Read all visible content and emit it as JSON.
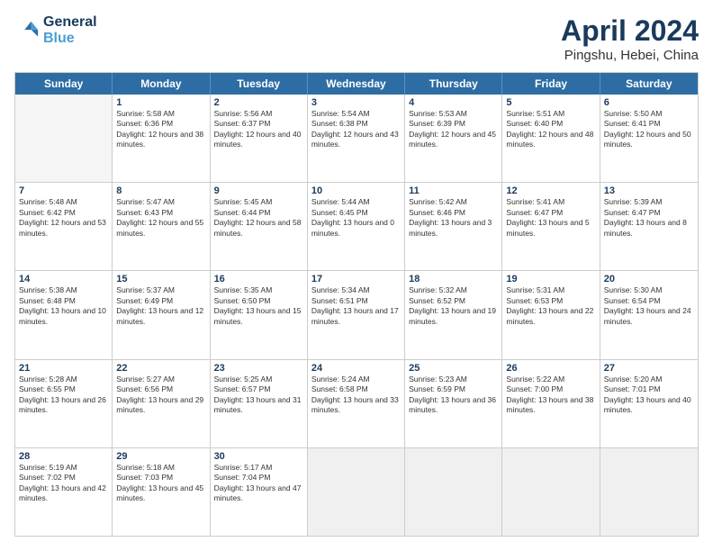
{
  "header": {
    "logo_line1": "General",
    "logo_line2": "Blue",
    "month": "April 2024",
    "location": "Pingshu, Hebei, China"
  },
  "days_of_week": [
    "Sunday",
    "Monday",
    "Tuesday",
    "Wednesday",
    "Thursday",
    "Friday",
    "Saturday"
  ],
  "weeks": [
    [
      {
        "day": "",
        "rise": "",
        "set": "",
        "daylight": "",
        "empty": true
      },
      {
        "day": "1",
        "rise": "Sunrise: 5:58 AM",
        "set": "Sunset: 6:36 PM",
        "daylight": "Daylight: 12 hours and 38 minutes."
      },
      {
        "day": "2",
        "rise": "Sunrise: 5:56 AM",
        "set": "Sunset: 6:37 PM",
        "daylight": "Daylight: 12 hours and 40 minutes."
      },
      {
        "day": "3",
        "rise": "Sunrise: 5:54 AM",
        "set": "Sunset: 6:38 PM",
        "daylight": "Daylight: 12 hours and 43 minutes."
      },
      {
        "day": "4",
        "rise": "Sunrise: 5:53 AM",
        "set": "Sunset: 6:39 PM",
        "daylight": "Daylight: 12 hours and 45 minutes."
      },
      {
        "day": "5",
        "rise": "Sunrise: 5:51 AM",
        "set": "Sunset: 6:40 PM",
        "daylight": "Daylight: 12 hours and 48 minutes."
      },
      {
        "day": "6",
        "rise": "Sunrise: 5:50 AM",
        "set": "Sunset: 6:41 PM",
        "daylight": "Daylight: 12 hours and 50 minutes."
      }
    ],
    [
      {
        "day": "7",
        "rise": "Sunrise: 5:48 AM",
        "set": "Sunset: 6:42 PM",
        "daylight": "Daylight: 12 hours and 53 minutes."
      },
      {
        "day": "8",
        "rise": "Sunrise: 5:47 AM",
        "set": "Sunset: 6:43 PM",
        "daylight": "Daylight: 12 hours and 55 minutes."
      },
      {
        "day": "9",
        "rise": "Sunrise: 5:45 AM",
        "set": "Sunset: 6:44 PM",
        "daylight": "Daylight: 12 hours and 58 minutes."
      },
      {
        "day": "10",
        "rise": "Sunrise: 5:44 AM",
        "set": "Sunset: 6:45 PM",
        "daylight": "Daylight: 13 hours and 0 minutes."
      },
      {
        "day": "11",
        "rise": "Sunrise: 5:42 AM",
        "set": "Sunset: 6:46 PM",
        "daylight": "Daylight: 13 hours and 3 minutes."
      },
      {
        "day": "12",
        "rise": "Sunrise: 5:41 AM",
        "set": "Sunset: 6:47 PM",
        "daylight": "Daylight: 13 hours and 5 minutes."
      },
      {
        "day": "13",
        "rise": "Sunrise: 5:39 AM",
        "set": "Sunset: 6:47 PM",
        "daylight": "Daylight: 13 hours and 8 minutes."
      }
    ],
    [
      {
        "day": "14",
        "rise": "Sunrise: 5:38 AM",
        "set": "Sunset: 6:48 PM",
        "daylight": "Daylight: 13 hours and 10 minutes."
      },
      {
        "day": "15",
        "rise": "Sunrise: 5:37 AM",
        "set": "Sunset: 6:49 PM",
        "daylight": "Daylight: 13 hours and 12 minutes."
      },
      {
        "day": "16",
        "rise": "Sunrise: 5:35 AM",
        "set": "Sunset: 6:50 PM",
        "daylight": "Daylight: 13 hours and 15 minutes."
      },
      {
        "day": "17",
        "rise": "Sunrise: 5:34 AM",
        "set": "Sunset: 6:51 PM",
        "daylight": "Daylight: 13 hours and 17 minutes."
      },
      {
        "day": "18",
        "rise": "Sunrise: 5:32 AM",
        "set": "Sunset: 6:52 PM",
        "daylight": "Daylight: 13 hours and 19 minutes."
      },
      {
        "day": "19",
        "rise": "Sunrise: 5:31 AM",
        "set": "Sunset: 6:53 PM",
        "daylight": "Daylight: 13 hours and 22 minutes."
      },
      {
        "day": "20",
        "rise": "Sunrise: 5:30 AM",
        "set": "Sunset: 6:54 PM",
        "daylight": "Daylight: 13 hours and 24 minutes."
      }
    ],
    [
      {
        "day": "21",
        "rise": "Sunrise: 5:28 AM",
        "set": "Sunset: 6:55 PM",
        "daylight": "Daylight: 13 hours and 26 minutes."
      },
      {
        "day": "22",
        "rise": "Sunrise: 5:27 AM",
        "set": "Sunset: 6:56 PM",
        "daylight": "Daylight: 13 hours and 29 minutes."
      },
      {
        "day": "23",
        "rise": "Sunrise: 5:25 AM",
        "set": "Sunset: 6:57 PM",
        "daylight": "Daylight: 13 hours and 31 minutes."
      },
      {
        "day": "24",
        "rise": "Sunrise: 5:24 AM",
        "set": "Sunset: 6:58 PM",
        "daylight": "Daylight: 13 hours and 33 minutes."
      },
      {
        "day": "25",
        "rise": "Sunrise: 5:23 AM",
        "set": "Sunset: 6:59 PM",
        "daylight": "Daylight: 13 hours and 36 minutes."
      },
      {
        "day": "26",
        "rise": "Sunrise: 5:22 AM",
        "set": "Sunset: 7:00 PM",
        "daylight": "Daylight: 13 hours and 38 minutes."
      },
      {
        "day": "27",
        "rise": "Sunrise: 5:20 AM",
        "set": "Sunset: 7:01 PM",
        "daylight": "Daylight: 13 hours and 40 minutes."
      }
    ],
    [
      {
        "day": "28",
        "rise": "Sunrise: 5:19 AM",
        "set": "Sunset: 7:02 PM",
        "daylight": "Daylight: 13 hours and 42 minutes."
      },
      {
        "day": "29",
        "rise": "Sunrise: 5:18 AM",
        "set": "Sunset: 7:03 PM",
        "daylight": "Daylight: 13 hours and 45 minutes."
      },
      {
        "day": "30",
        "rise": "Sunrise: 5:17 AM",
        "set": "Sunset: 7:04 PM",
        "daylight": "Daylight: 13 hours and 47 minutes."
      },
      {
        "day": "",
        "rise": "",
        "set": "",
        "daylight": "",
        "empty": true,
        "shaded": true
      },
      {
        "day": "",
        "rise": "",
        "set": "",
        "daylight": "",
        "empty": true,
        "shaded": true
      },
      {
        "day": "",
        "rise": "",
        "set": "",
        "daylight": "",
        "empty": true,
        "shaded": true
      },
      {
        "day": "",
        "rise": "",
        "set": "",
        "daylight": "",
        "empty": true,
        "shaded": true
      }
    ]
  ]
}
